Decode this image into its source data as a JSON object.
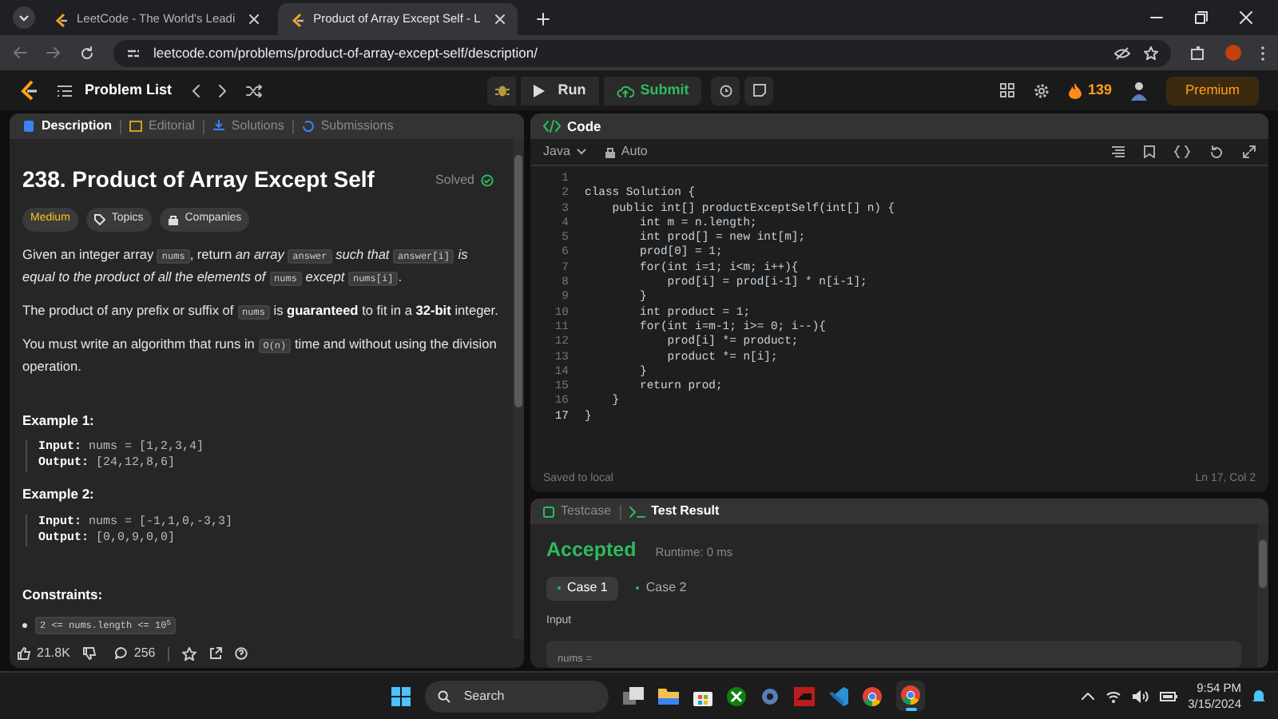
{
  "browser": {
    "tabs": [
      {
        "title": "LeetCode - The World's Leadi",
        "selected": false
      },
      {
        "title": "Product of Array Except Self - L",
        "selected": true
      }
    ],
    "url": "leetcode.com/problems/product-of-array-except-self/description/"
  },
  "nav": {
    "problem_list": "Problem List",
    "run": "Run",
    "submit": "Submit",
    "streak": "139",
    "premium": "Premium"
  },
  "description_panel": {
    "tabs": [
      {
        "label": "Description",
        "selected": true
      },
      {
        "label": "Editorial",
        "selected": false
      },
      {
        "label": "Solutions",
        "selected": false
      },
      {
        "label": "Submissions",
        "selected": false
      }
    ],
    "title": "238. Product of Array Except Self",
    "status": "Solved",
    "tags": [
      {
        "label": "Medium",
        "kind": "difficulty"
      },
      {
        "label": "Topics",
        "kind": "topics"
      },
      {
        "label": "Companies",
        "kind": "companies"
      }
    ],
    "paragraphs": [
      [
        {
          "kind": "text",
          "t": "Given an integer array "
        },
        {
          "kind": "code",
          "t": "nums"
        },
        {
          "kind": "text",
          "t": ", return "
        },
        {
          "kind": "italic",
          "t": "an array "
        },
        {
          "kind": "code",
          "t": "answer"
        },
        {
          "kind": "italic",
          "t": " such that "
        },
        {
          "kind": "code",
          "t": "answer[i]"
        },
        {
          "kind": "italic",
          "t": " is equal to the product of all the elements of "
        },
        {
          "kind": "code",
          "t": "nums"
        },
        {
          "kind": "italic",
          "t": " except "
        },
        {
          "kind": "code",
          "t": "nums[i]"
        },
        {
          "kind": "text",
          "t": "."
        }
      ],
      [
        {
          "kind": "text",
          "t": "The product of any prefix or suffix of "
        },
        {
          "kind": "code",
          "t": "nums"
        },
        {
          "kind": "text",
          "t": " is "
        },
        {
          "kind": "bold",
          "t": "guaranteed"
        },
        {
          "kind": "text",
          "t": " to fit in a "
        },
        {
          "kind": "bold",
          "t": "32-bit"
        },
        {
          "kind": "text",
          "t": " integer."
        }
      ],
      [
        {
          "kind": "text",
          "t": "You must write an algorithm that runs in "
        },
        {
          "kind": "code",
          "t": "O(n)"
        },
        {
          "kind": "text",
          "t": " time and without using the division operation."
        }
      ]
    ],
    "examples": [
      {
        "heading": "Example 1:",
        "input_label": "Input:",
        "input": "nums = [1,2,3,4]",
        "output_label": "Output:",
        "output": "[24,12,8,6]"
      },
      {
        "heading": "Example 2:",
        "input_label": "Input:",
        "input": "nums = [-1,1,0,-3,3]",
        "output_label": "Output:",
        "output": "[0,0,9,0,0]"
      }
    ],
    "constraints_heading": "Constraints:",
    "constraints": [
      {
        "text": "2 <= nums.length <= 10$^{5}$"
      }
    ],
    "footer": {
      "likes": "21.8K",
      "comments": "256"
    }
  },
  "code_panel": {
    "title": "Code",
    "language": "Java",
    "mode": "Auto",
    "lines": [
      {
        "number": "1"
      },
      {
        "number": "2",
        "text": "class Solution {"
      },
      {
        "number": "3",
        "text": "    public int[] productExceptSelf(int[] n) {"
      },
      {
        "number": "4",
        "text": "        int m = n.length;"
      },
      {
        "number": "5",
        "text": "        int prod[] = new int[m];"
      },
      {
        "number": "6",
        "text": "        prod[0] = 1;"
      },
      {
        "number": "7",
        "text": "        for(int i=1; i<m; i++){"
      },
      {
        "number": "8",
        "text": "            prod[i] = prod[i-1] * n[i-1];"
      },
      {
        "number": "9",
        "text": "        }"
      },
      {
        "number": "10",
        "text": "        int product = 1;"
      },
      {
        "number": "11",
        "text": "        for(int i=m-1; i>= 0; i--){"
      },
      {
        "number": "12",
        "text": "            prod[i] *= product;"
      },
      {
        "number": "13",
        "text": "            product *= n[i];"
      },
      {
        "number": "14",
        "text": "        }"
      },
      {
        "number": "15",
        "text": "        return prod;"
      },
      {
        "number": "16",
        "text": "    }"
      },
      {
        "number": "17",
        "text": "}",
        "current": true
      }
    ],
    "saved": "Saved to local",
    "cursor": "Ln 17, Col 2"
  },
  "result_panel": {
    "tabs": [
      {
        "label": "Testcase",
        "selected": false
      },
      {
        "label": "Test Result",
        "selected": true
      }
    ],
    "verdict": "Accepted",
    "runtime": "Runtime: 0 ms",
    "cases": [
      {
        "label": "Case 1",
        "selected": true
      },
      {
        "label": "Case 2",
        "selected": false
      }
    ],
    "input_label": "Input",
    "input_var": "nums ="
  },
  "taskbar": {
    "search": "Search",
    "time": "9:54 PM",
    "date": "3/15/2024"
  }
}
